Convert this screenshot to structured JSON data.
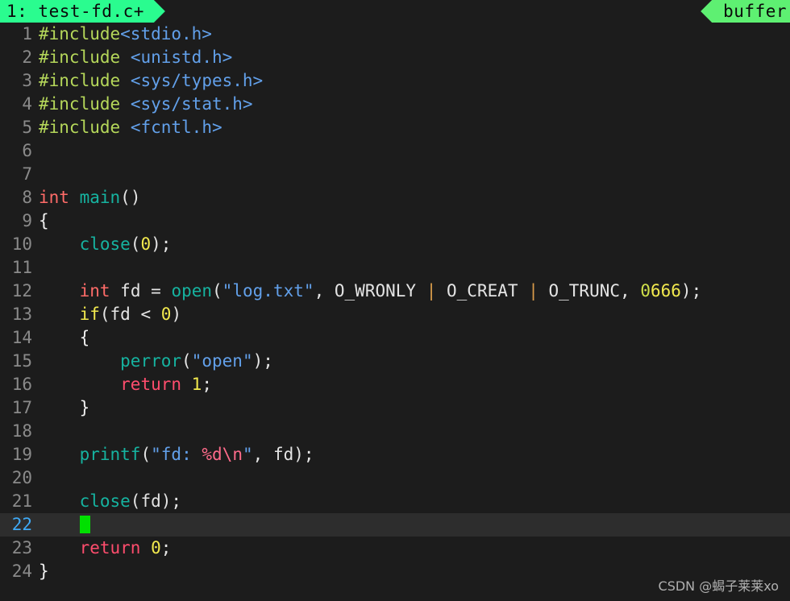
{
  "tabbar": {
    "left_tab": "1: test-fd.c+",
    "right_tab": "buffer",
    "tab_color": "#2afc8f",
    "right_tab_color": "#5ef072"
  },
  "editor": {
    "background": "#1c1c1c",
    "current_line_background": "#2d2d2d",
    "cursor_color": "#00e000",
    "current_line": 22,
    "lines": [
      {
        "n": "1",
        "text": "#include<stdio.h>"
      },
      {
        "n": "2",
        "text": "#include <unistd.h>"
      },
      {
        "n": "3",
        "text": "#include <sys/types.h>"
      },
      {
        "n": "4",
        "text": "#include <sys/stat.h>"
      },
      {
        "n": "5",
        "text": "#include <fcntl.h>"
      },
      {
        "n": "6",
        "text": ""
      },
      {
        "n": "7",
        "text": ""
      },
      {
        "n": "8",
        "text": "int main()"
      },
      {
        "n": "9",
        "text": "{"
      },
      {
        "n": "10",
        "text": "    close(0);"
      },
      {
        "n": "11",
        "text": ""
      },
      {
        "n": "12",
        "text": "    int fd = open(\"log.txt\", O_WRONLY | O_CREAT | O_TRUNC, 0666);"
      },
      {
        "n": "13",
        "text": "    if(fd < 0)"
      },
      {
        "n": "14",
        "text": "    {"
      },
      {
        "n": "15",
        "text": "        perror(\"open\");"
      },
      {
        "n": "16",
        "text": "        return 1;"
      },
      {
        "n": "17",
        "text": "    }"
      },
      {
        "n": "18",
        "text": ""
      },
      {
        "n": "19",
        "text": "    printf(\"fd: %d\\n\", fd);"
      },
      {
        "n": "20",
        "text": ""
      },
      {
        "n": "21",
        "text": "    close(fd);"
      },
      {
        "n": "22",
        "text": "    "
      },
      {
        "n": "23",
        "text": "    return 0;"
      },
      {
        "n": "24",
        "text": "}"
      }
    ]
  },
  "watermark": {
    "text": "CSDN @蝎子莱莱xo"
  }
}
